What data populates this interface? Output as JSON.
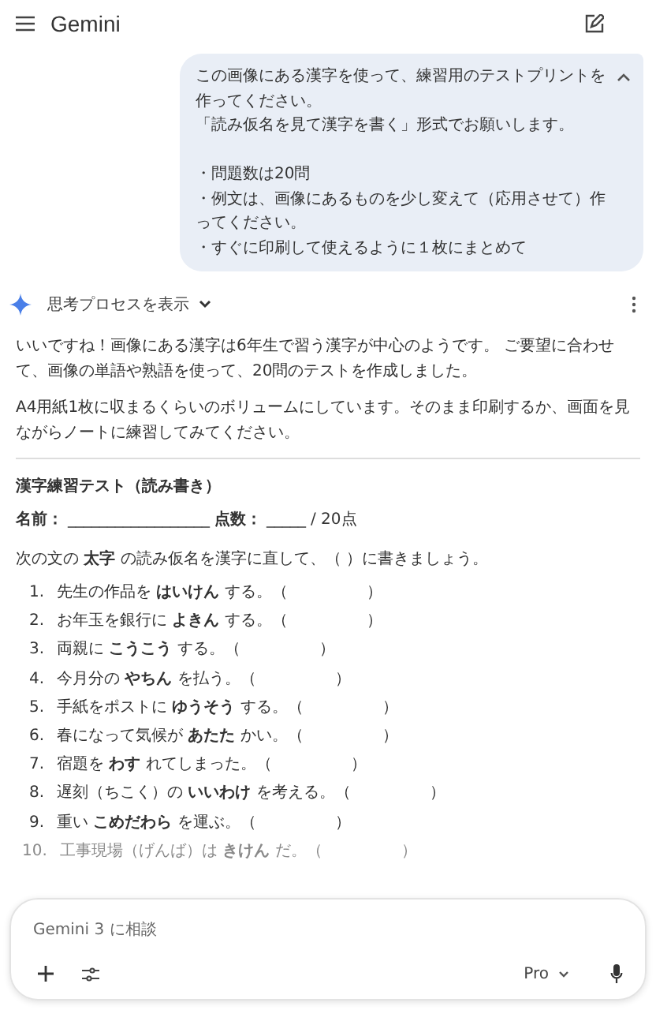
{
  "header": {
    "title": "Gemini"
  },
  "user_message": {
    "expanded": true,
    "paragraphs": [
      [
        "この画像にある漢字を使って、練習用のテストプリントを作ってください。",
        "「読み仮名を見て漢字を書く」形式でお願いします。"
      ],
      [
        "・問題数は20問",
        "・例文は、画像にあるものを少し変えて（応用させて）作ってください。",
        "・すぐに印刷して使えるように１枚にまとめて"
      ]
    ]
  },
  "response": {
    "thinking_toggle": "思考プロセスを表示",
    "paragraphs": [
      "いいですね！画像にある漢字は6年生で習う漢字が中心のようです。 ご要望に合わせて、画像の単語や熟語を使って、20問のテストを作成しました。",
      "A4用紙1枚に収まるくらいのボリュームにしています。そのまま印刷するか、画面を見ながらノートに練習してみてください。"
    ],
    "test_title": "漢字練習テスト（読み書き）",
    "name_label": "名前：",
    "name_blank": "__________________",
    "score_label": "点数：",
    "score_blank": "_____",
    "score_total": "/ 20点",
    "instruction": "次の文の **太字** の読み仮名を漢字に直して、（  ）に書きましょう。",
    "questions": [
      {
        "number": "1.",
        "text": "先生の作品を **はいけん** する。（　　　　　）",
        "faded": false
      },
      {
        "number": "2.",
        "text": "お年玉を銀行に **よきん** する。（　　　　　）",
        "faded": false
      },
      {
        "number": "3.",
        "text": "両親に **こうこう** する。（　　　　　）",
        "faded": false
      },
      {
        "number": "4.",
        "text": "今月分の **やちん** を払う。（　　　　　）",
        "faded": false
      },
      {
        "number": "5.",
        "text": "手紙をポストに **ゆうそう** する。（　　　　　）",
        "faded": false
      },
      {
        "number": "6.",
        "text": "春になって気候が **あたた** かい。（　　　　　）",
        "faded": false
      },
      {
        "number": "7.",
        "text": "宿題を **わす** れてしまった。（　　　　　）",
        "faded": false
      },
      {
        "number": "8.",
        "text": "遅刻（ちこく）の **いいわけ** を考える。（　　　　　）",
        "faded": false
      },
      {
        "number": "9.",
        "text": "重い **こめだわら** を運ぶ。（　　　　　）",
        "faded": false
      },
      {
        "number": "10.",
        "text": "工事現場（げんば）は **きけん** だ。（　　　　　）",
        "faded": true
      }
    ]
  },
  "composer": {
    "placeholder": "Gemini 3 に相談",
    "model": "Pro"
  }
}
